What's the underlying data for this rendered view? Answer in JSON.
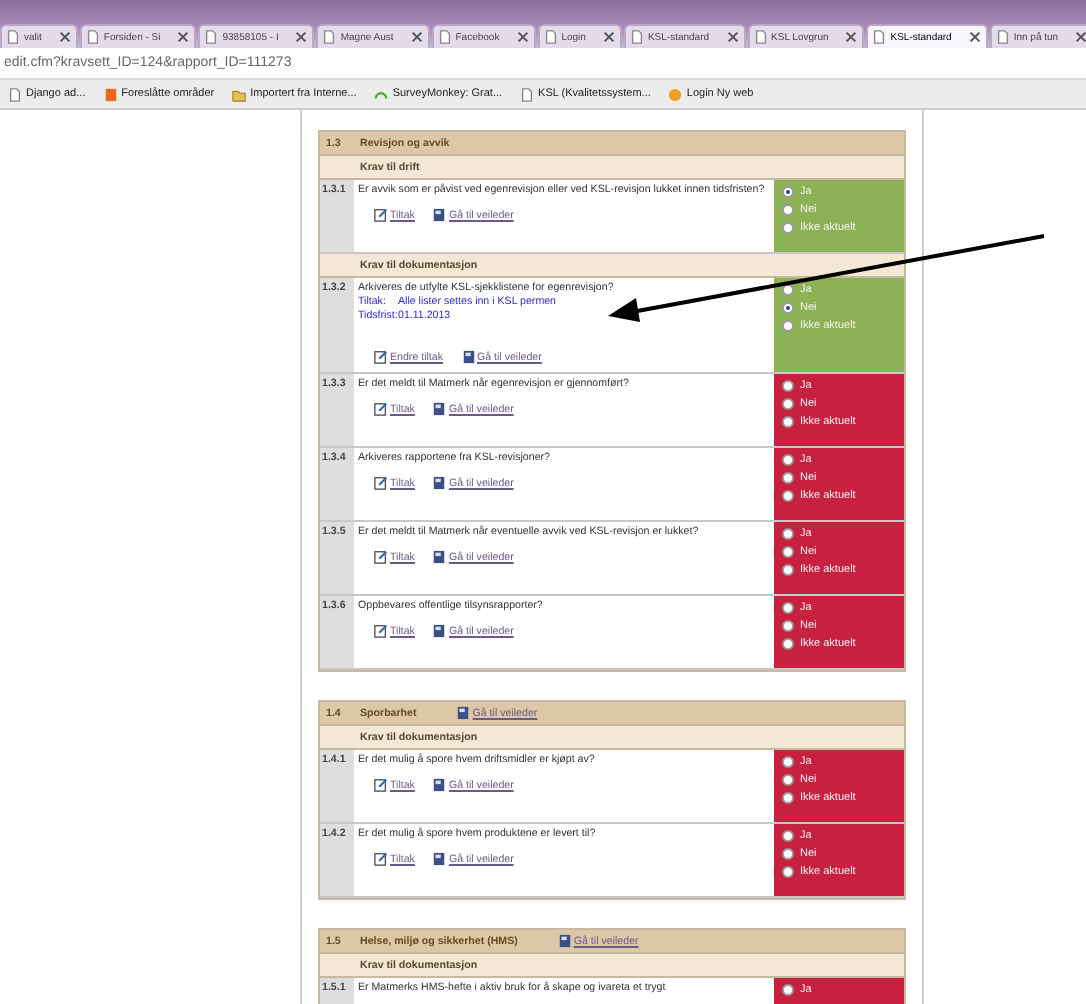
{
  "browser": {
    "tabs": [
      {
        "title": "valit",
        "selected": false
      },
      {
        "title": "Forsiden - Si",
        "selected": false
      },
      {
        "title": "93858105 - I",
        "selected": false
      },
      {
        "title": "Magne Aust",
        "selected": false
      },
      {
        "title": "Facebook",
        "selected": false
      },
      {
        "title": "Login",
        "selected": false
      },
      {
        "title": "KSL-standard",
        "selected": false
      },
      {
        "title": "KSL Lovgrun",
        "selected": false
      },
      {
        "title": "KSL-standard",
        "selected": true
      },
      {
        "title": "Inn på tun",
        "selected": false
      }
    ],
    "address": "edit.cfm?kravsett_ID=124&rapport_ID=111273",
    "bookmarks": [
      "Django ad...",
      "Foreslåtte områder",
      "Importert fra Interne...",
      "SurveyMonkey: Grat...",
      "KSL (Kvalitetssystem...",
      "Login Ny web"
    ]
  },
  "sections": [
    {
      "number": "1.3",
      "title": "Revisjon og avvik",
      "groups": [
        {
          "heading": "Krav til drift",
          "items": [
            {
              "number": "1.3.1",
              "question": "Er avvik som er påvist ved egenrevisjon eller ved KSL-revisjon lukket innen tidsfristen?",
              "actions": [
                "Tiltak",
                "Gå til veileder"
              ],
              "color": "#8db255",
              "options": [
                {
                  "label": "Ja",
                  "selected": true
                },
                {
                  "label": "Nei",
                  "selected": false
                },
                {
                  "label": "Ikke aktuelt",
                  "selected": false
                }
              ]
            }
          ]
        },
        {
          "heading": "Krav til dokumentasjon",
          "items": [
            {
              "number": "1.3.2",
              "question": "Arkiveres de utfylte KSL-sjekklistene for egenrevisjon?",
              "measure_label": "Tiltak:",
              "measure": "Alle lister settes inn i KSL permen",
              "deadline_label": "Tidsfrist:",
              "deadline": "01.11.2013",
              "actions": [
                "Endre tiltak",
                "Gå til veileder"
              ],
              "color": "#8db255",
              "options": [
                {
                  "label": "Ja",
                  "selected": false
                },
                {
                  "label": "Nei",
                  "selected": true
                },
                {
                  "label": "Ikke aktuelt",
                  "selected": false
                }
              ]
            },
            {
              "number": "1.3.3",
              "question": "Er det meldt til Matmerk når egenrevisjon er gjennomført?",
              "actions": [
                "Tiltak",
                "Gå til veileder"
              ],
              "color": "#c8203f",
              "options": [
                {
                  "label": "Ja",
                  "selected": false
                },
                {
                  "label": "Nei",
                  "selected": false
                },
                {
                  "label": "Ikke aktuelt",
                  "selected": false
                }
              ]
            },
            {
              "number": "1.3.4",
              "question": "Arkiveres rapportene fra KSL-revisjoner?",
              "actions": [
                "Tiltak",
                "Gå til veileder"
              ],
              "color": "#c8203f",
              "options": [
                {
                  "label": "Ja",
                  "selected": false
                },
                {
                  "label": "Nei",
                  "selected": false
                },
                {
                  "label": "Ikke aktuelt",
                  "selected": false
                }
              ]
            },
            {
              "number": "1.3.5",
              "question": "Er det meldt til Matmerk når eventuelle avvik ved KSL-revisjon er lukket?",
              "actions": [
                "Tiltak",
                "Gå til veileder"
              ],
              "color": "#c8203f",
              "options": [
                {
                  "label": "Ja",
                  "selected": false
                },
                {
                  "label": "Nei",
                  "selected": false
                },
                {
                  "label": "Ikke aktuelt",
                  "selected": false
                }
              ]
            },
            {
              "number": "1.3.6",
              "question": "Oppbevares offentlige tilsynsrapporter?",
              "actions": [
                "Tiltak",
                "Gå til veileder"
              ],
              "color": "#c8203f",
              "options": [
                {
                  "label": "Ja",
                  "selected": false
                },
                {
                  "label": "Nei",
                  "selected": false
                },
                {
                  "label": "Ikke aktuelt",
                  "selected": false
                }
              ]
            }
          ]
        }
      ]
    },
    {
      "number": "1.4",
      "title": "Sporbarhet",
      "guide": "Gå til veileder",
      "groups": [
        {
          "heading": "Krav til dokumentasjon",
          "items": [
            {
              "number": "1.4.1",
              "question": "Er det mulig å spore hvem driftsmidler er kjøpt av?",
              "actions": [
                "Tiltak",
                "Gå til veileder"
              ],
              "color": "#c8203f",
              "options": [
                {
                  "label": "Ja",
                  "selected": false
                },
                {
                  "label": "Nei",
                  "selected": false
                },
                {
                  "label": "Ikke aktuelt",
                  "selected": false
                }
              ]
            },
            {
              "number": "1.4.2",
              "question": "Er det mulig å spore hvem produktene er levert til?",
              "actions": [
                "Tiltak",
                "Gå til veileder"
              ],
              "color": "#c8203f",
              "options": [
                {
                  "label": "Ja",
                  "selected": false
                },
                {
                  "label": "Nei",
                  "selected": false
                },
                {
                  "label": "Ikke aktuelt",
                  "selected": false
                }
              ]
            }
          ]
        }
      ]
    },
    {
      "number": "1.5",
      "title": "Helse, miljø og sikkerhet (HMS)",
      "guide": "Gå til veileder",
      "groups": [
        {
          "heading": "Krav til dokumentasjon",
          "items": [
            {
              "number": "1.5.1",
              "question": "Er Matmerks HMS-hefte i aktiv bruk for å skape og ivareta et trygt",
              "color": "#c8203f",
              "options": [
                {
                  "label": "Ja",
                  "selected": false
                }
              ]
            }
          ]
        }
      ]
    }
  ]
}
